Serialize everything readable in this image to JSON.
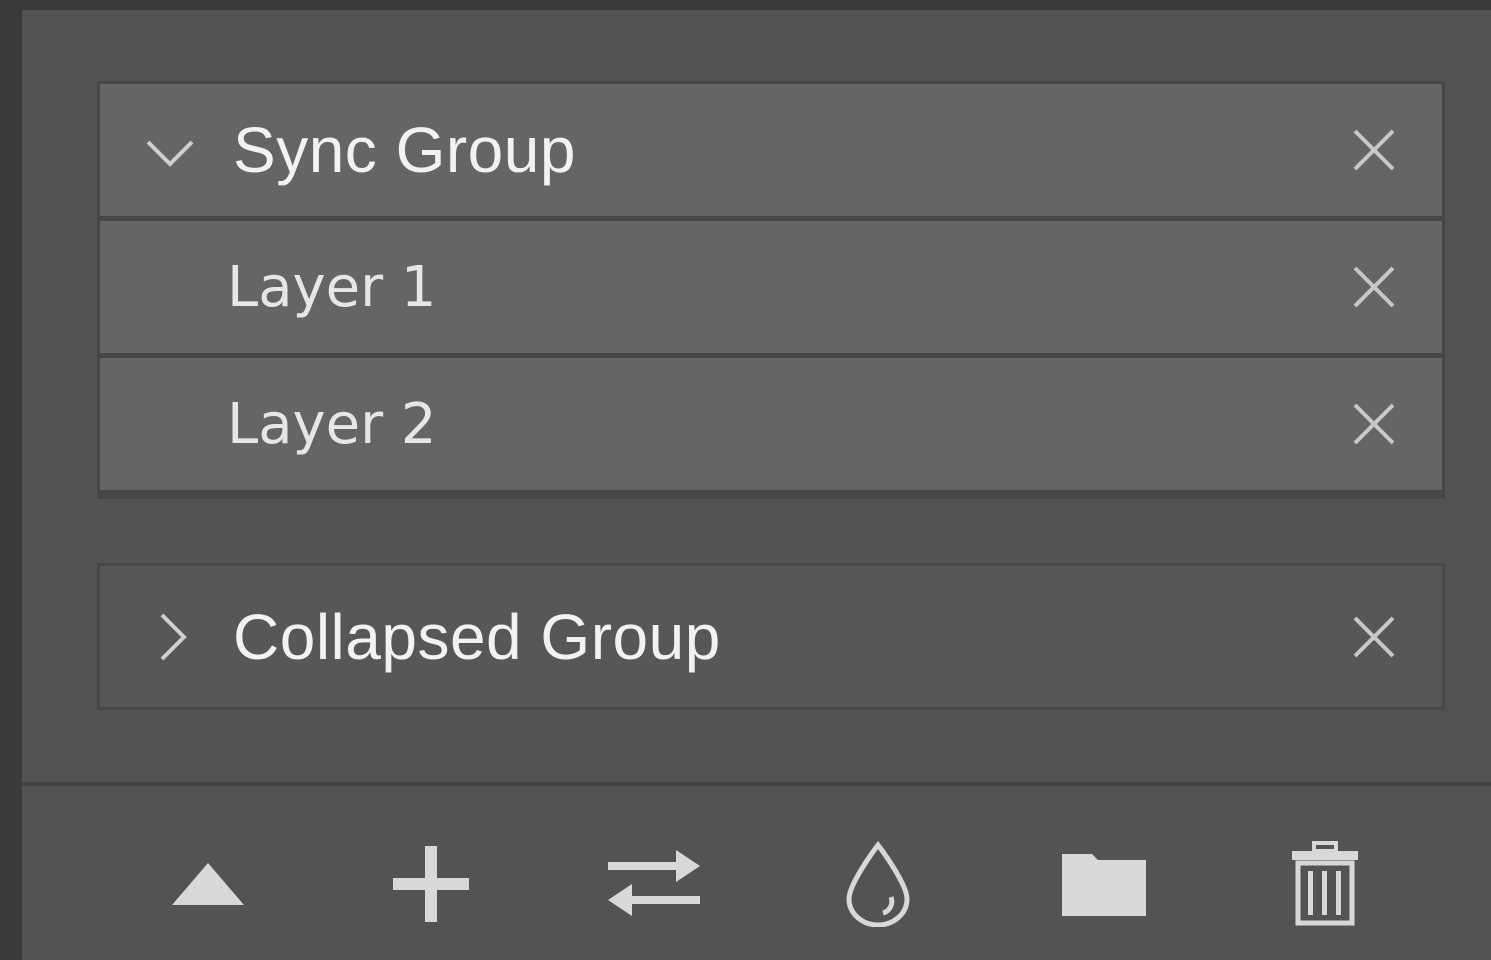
{
  "groups": [
    {
      "label": "Sync Group",
      "state": "expanded",
      "chevron_icon": "chevron-down-icon",
      "layers": [
        {
          "label": "Layer 1"
        },
        {
          "label": "Layer 2"
        }
      ]
    },
    {
      "label": "Collapsed Group",
      "state": "collapsed",
      "chevron_icon": "chevron-right-icon",
      "layers": []
    }
  ],
  "toolbar": {
    "buttons": [
      {
        "icon": "triangle-up-icon"
      },
      {
        "icon": "plus-icon"
      },
      {
        "icon": "swap-arrows-icon"
      },
      {
        "icon": "droplet-icon"
      },
      {
        "icon": "folder-icon"
      },
      {
        "icon": "trash-icon"
      }
    ]
  },
  "colors": {
    "panel_bg": "#535353",
    "row_bg": "#656565",
    "text": "#f2f2f2",
    "icon": "#d0d0d0"
  }
}
